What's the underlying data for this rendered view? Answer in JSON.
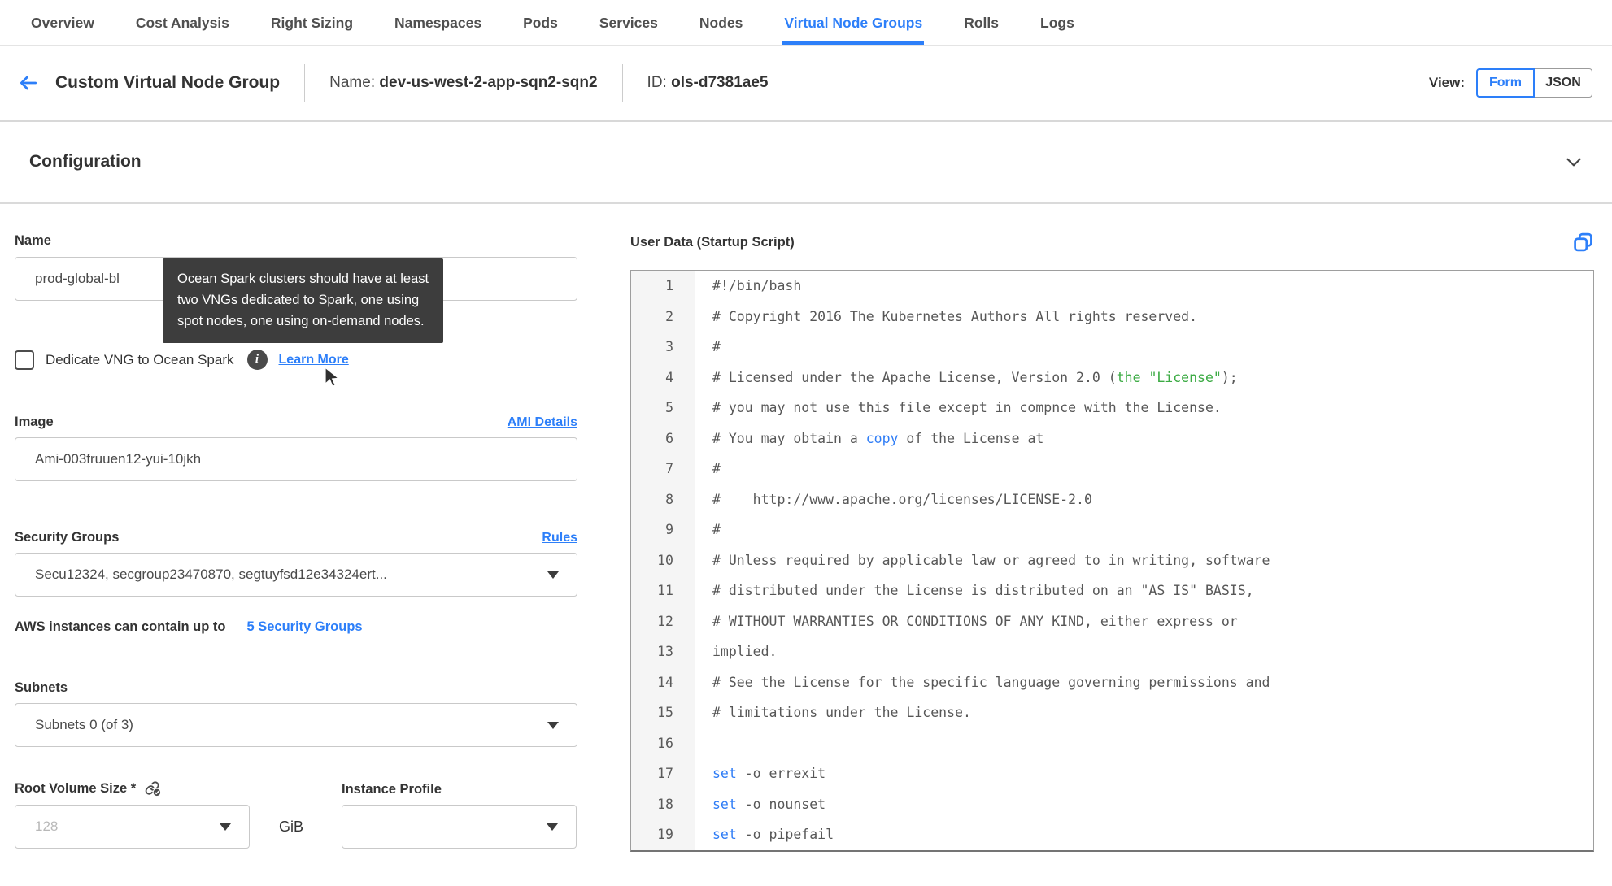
{
  "colors": {
    "accent_blue": "#2d7ff9",
    "tooltip_bg": "#3d3d3d",
    "syntax_green": "#3cab44",
    "syntax_blue": "#2e7cf6"
  },
  "tabs": {
    "items": [
      {
        "label": "Overview",
        "active": false
      },
      {
        "label": "Cost Analysis",
        "active": false
      },
      {
        "label": "Right Sizing",
        "active": false
      },
      {
        "label": "Namespaces",
        "active": false
      },
      {
        "label": "Pods",
        "active": false
      },
      {
        "label": "Services",
        "active": false
      },
      {
        "label": "Nodes",
        "active": false
      },
      {
        "label": "Virtual Node Groups",
        "active": true
      },
      {
        "label": "Rolls",
        "active": false
      },
      {
        "label": "Logs",
        "active": false
      }
    ]
  },
  "header": {
    "title": "Custom Virtual Node Group",
    "name_label": "Name:",
    "name_value": "dev-us-west-2-app-sqn2-sqn2",
    "id_label": "ID:",
    "id_value": "ols-d7381ae5",
    "view_label": "View:",
    "view_options": [
      "Form",
      "JSON"
    ],
    "active_view": "Form"
  },
  "configuration": {
    "title": "Configuration"
  },
  "tooltip": {
    "text": "Ocean Spark clusters should have at least\ntwo VNGs dedicated to Spark, one using\nspot nodes, one using on-demand nodes."
  },
  "form": {
    "name": {
      "label": "Name",
      "value": "prod-global-bl"
    },
    "dedicate": {
      "label": "Dedicate VNG to Ocean Spark",
      "checked": false,
      "info_glyph": "i",
      "learn_more_label": "Learn More"
    },
    "image": {
      "label": "Image",
      "link_label": "AMI Details",
      "value": "Ami-003fruuen12-yui-10jkh"
    },
    "security_groups": {
      "label": "Security Groups",
      "link_label": "Rules",
      "value": "Secu12324, secgroup23470870, segtuyfsd12e34324ert...",
      "hint_text": "AWS instances can contain up to",
      "hint_link": "5 Security Groups"
    },
    "subnets": {
      "label": "Subnets",
      "value": "Subnets 0 (of 3)"
    },
    "root_volume": {
      "label": "Root Volume Size *",
      "placeholder": "128",
      "unit": "GiB"
    },
    "instance_profile": {
      "label": "Instance Profile",
      "value": ""
    }
  },
  "editor": {
    "title": "User Data (Startup Script)",
    "lines": [
      {
        "num": 1,
        "segments": [
          {
            "text": "#!/bin/bash",
            "color": "d"
          }
        ]
      },
      {
        "num": 2,
        "segments": [
          {
            "text": "# Copyright 2016 The Kubernetes Authors All rights reserved.",
            "color": "d"
          }
        ]
      },
      {
        "num": 3,
        "segments": [
          {
            "text": "#",
            "color": "d"
          }
        ]
      },
      {
        "num": 4,
        "segments": [
          {
            "text": "# Licensed under the Apache License, Version 2.0 (",
            "color": "d"
          },
          {
            "text": "the \"License\"",
            "color": "g"
          },
          {
            "text": ");",
            "color": "d"
          }
        ]
      },
      {
        "num": 5,
        "segments": [
          {
            "text": "# you may not use this file except in compnce with the License.",
            "color": "d"
          }
        ]
      },
      {
        "num": 6,
        "segments": [
          {
            "text": "# You may obtain a ",
            "color": "d"
          },
          {
            "text": "copy",
            "color": "b"
          },
          {
            "text": " of the License at",
            "color": "d"
          }
        ]
      },
      {
        "num": 7,
        "segments": [
          {
            "text": "#",
            "color": "d"
          }
        ]
      },
      {
        "num": 8,
        "segments": [
          {
            "text": "#    http://www.apache.org/licenses/LICENSE-2.0",
            "color": "d"
          }
        ]
      },
      {
        "num": 9,
        "segments": [
          {
            "text": "#",
            "color": "d"
          }
        ]
      },
      {
        "num": 10,
        "segments": [
          {
            "text": "# Unless required by applicable law or agreed to in writing, software",
            "color": "d"
          }
        ]
      },
      {
        "num": 11,
        "segments": [
          {
            "text": "# distributed under the License is distributed on an \"AS IS\" BASIS,",
            "color": "d"
          }
        ]
      },
      {
        "num": 12,
        "segments": [
          {
            "text": "# WITHOUT WARRANTIES OR CONDITIONS OF ANY KIND, either express or",
            "color": "d"
          }
        ]
      },
      {
        "num": 13,
        "segments": [
          {
            "text": "implied.",
            "color": "d"
          }
        ]
      },
      {
        "num": 14,
        "segments": [
          {
            "text": "# See the License for the specific language governing permissions and",
            "color": "d"
          }
        ]
      },
      {
        "num": 15,
        "segments": [
          {
            "text": "# limitations under the License.",
            "color": "d"
          }
        ]
      },
      {
        "num": 16,
        "segments": [
          {
            "text": "",
            "color": "d"
          }
        ]
      },
      {
        "num": 17,
        "segments": [
          {
            "text": "set",
            "color": "b"
          },
          {
            "text": " -o errexit",
            "color": "d"
          }
        ]
      },
      {
        "num": 18,
        "segments": [
          {
            "text": "set",
            "color": "b"
          },
          {
            "text": " -o nounset",
            "color": "d"
          }
        ]
      },
      {
        "num": 19,
        "segments": [
          {
            "text": "set",
            "color": "b"
          },
          {
            "text": " -o pipefail",
            "color": "d"
          }
        ]
      }
    ]
  }
}
